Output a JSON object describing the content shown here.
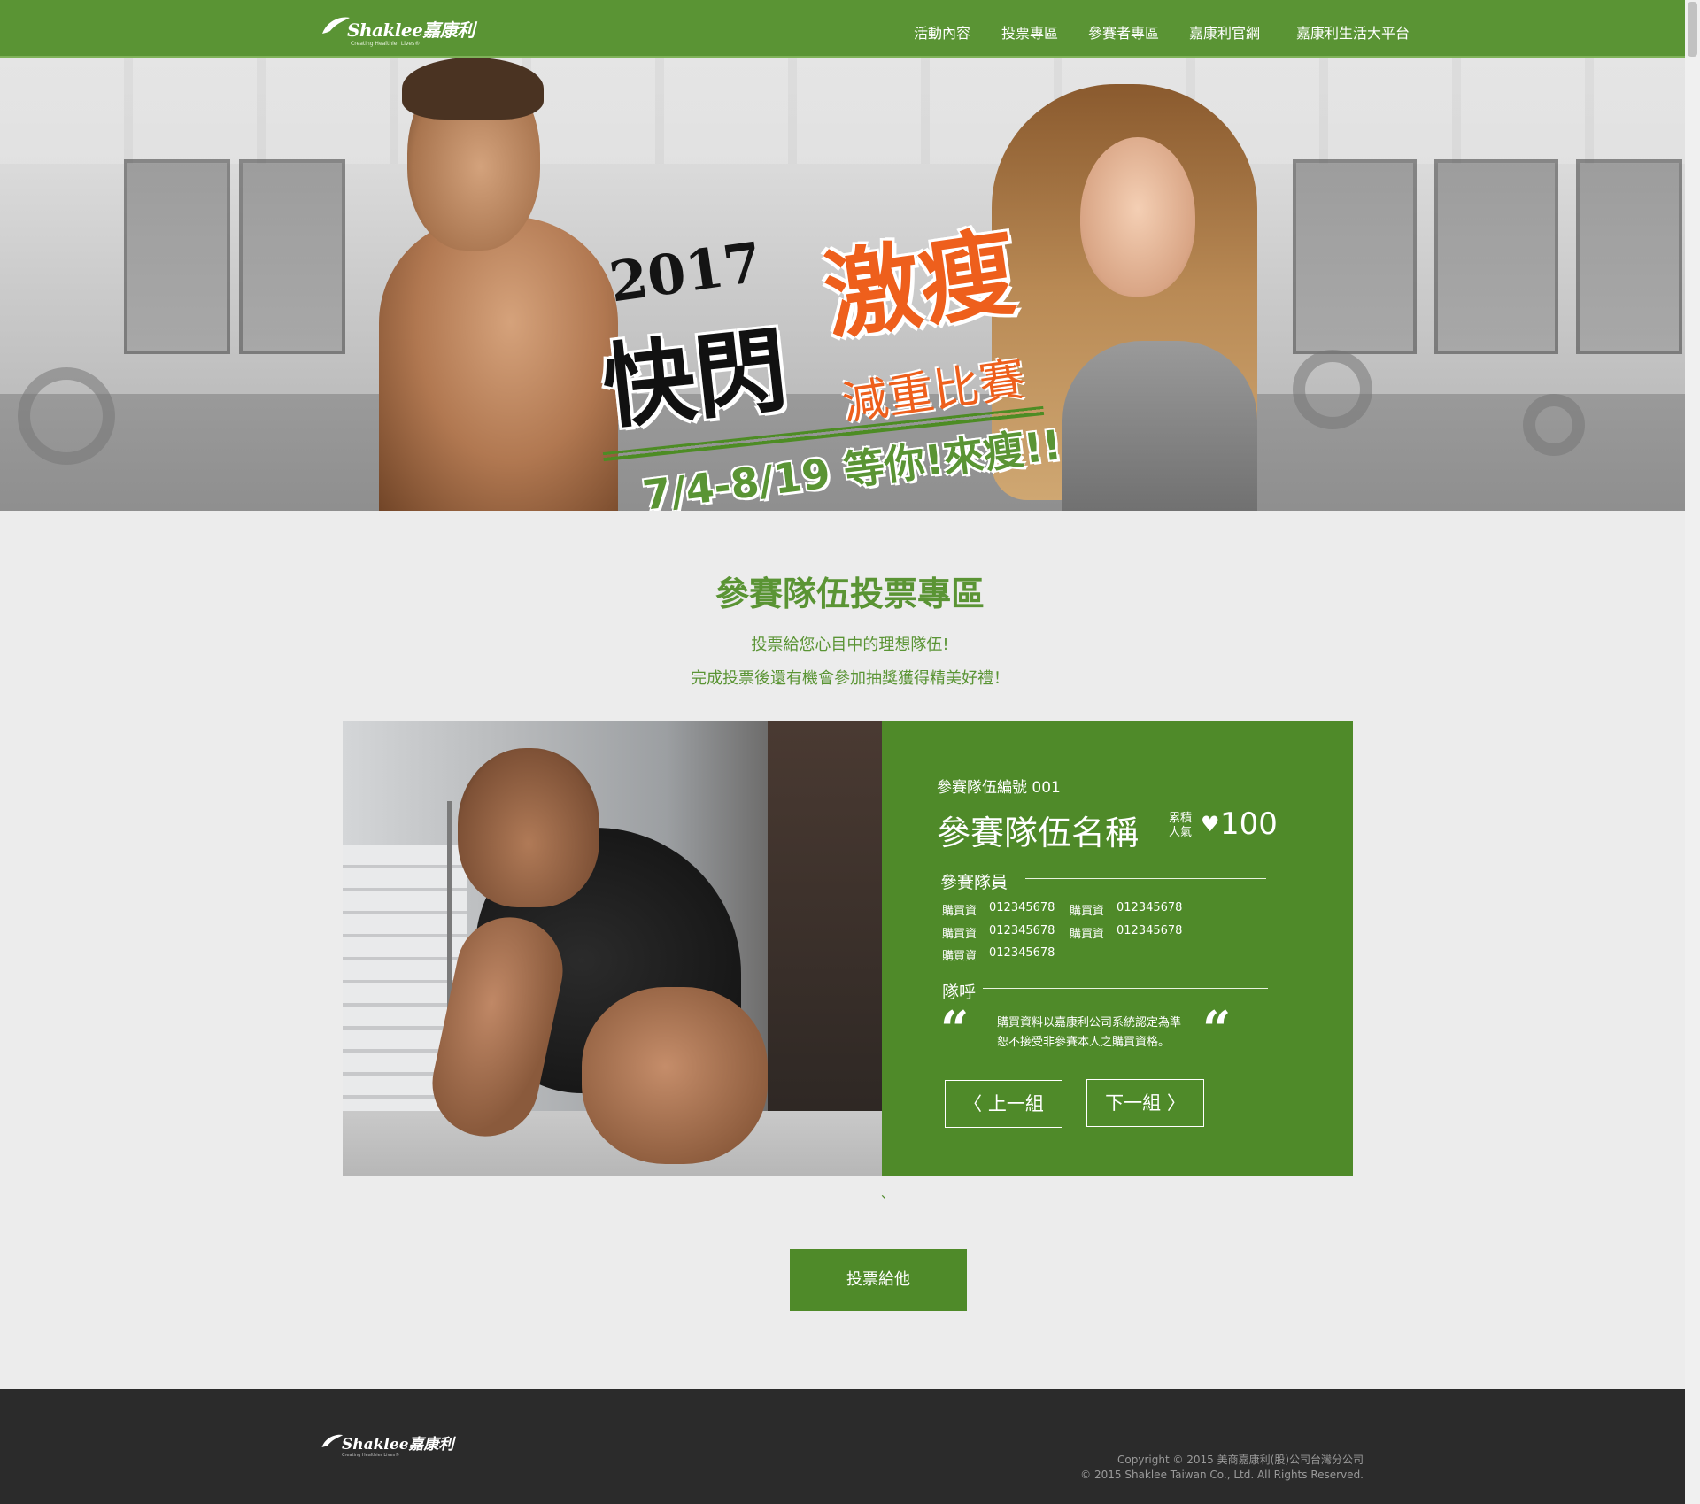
{
  "brand": {
    "logo_text": "Shaklee嘉康利",
    "tagline": "Creating Healthier Lives®",
    "accent_color": "#5a9434"
  },
  "nav": {
    "items": [
      "活動內容",
      "投票專區",
      "參賽者專區",
      "嘉康利官網",
      "嘉康利生活大平台"
    ]
  },
  "hero": {
    "year": "2017",
    "title_black": "快閃",
    "title_orange": "激瘦",
    "subtitle": "減重比賽",
    "dates": "7/4-8/19 等你!來瘦!!"
  },
  "vote_section": {
    "title": "參賽隊伍投票專區",
    "lines": [
      "投票給您心目中的理想隊伍!",
      "完成投票後還有機會參加抽獎獲得精美好禮！"
    ]
  },
  "team_card": {
    "team_number": "參賽隊伍編號 001",
    "team_name": "參賽隊伍名稱",
    "popularity_label": "累積人氣",
    "popularity_label_lines": [
      "累積",
      "人氣"
    ],
    "votes": "100",
    "members_title": "參賽隊員",
    "members": [
      {
        "label": "購買資",
        "value": "012345678"
      },
      {
        "label": "購買資",
        "value": "012345678"
      },
      {
        "label": "購買資",
        "value": "012345678"
      },
      {
        "label": "購買資",
        "value": "012345678"
      },
      {
        "label": "購買資",
        "value": "012345678"
      }
    ],
    "slogan_title": "隊呼",
    "slogan_lines": [
      "購買資料以嘉康利公司系統認定為準",
      "恕不接受非參賽本人之購買資格。"
    ],
    "prev_label": "〈 上一組",
    "next_label": "下一組 〉",
    "quote_open": "“",
    "quote_close": "“"
  },
  "vote_button": "投票給他",
  "stray_mark": "、",
  "footer": {
    "logo_text": "Shaklee嘉康利",
    "tagline": "Creating Healthier Lives®",
    "copyright_lines": [
      "Copyright © 2015 美商嘉康利(股)公司台灣分公司",
      "© 2015 Shaklee Taiwan Co., Ltd. All Rights Reserved."
    ]
  }
}
